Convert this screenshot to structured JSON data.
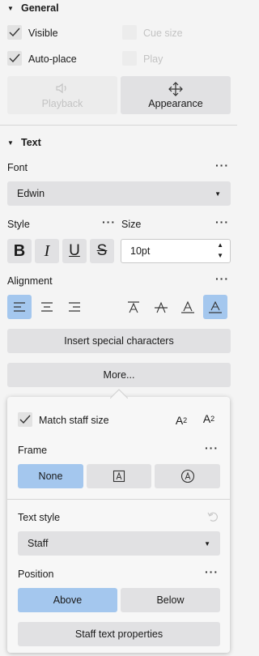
{
  "general": {
    "title": "General",
    "visible_label": "Visible",
    "autoplace_label": "Auto-place",
    "cuesize_label": "Cue size",
    "play_label": "Play",
    "playback_label": "Playback",
    "appearance_label": "Appearance"
  },
  "text": {
    "title": "Text",
    "font_label": "Font",
    "font_value": "Edwin",
    "style_label": "Style",
    "size_label": "Size",
    "size_value": "10pt",
    "alignment_label": "Alignment",
    "special_chars_label": "Insert special characters",
    "more_label": "More..."
  },
  "more_panel": {
    "match_staff_label": "Match staff size",
    "subscript_glyph": "A",
    "subscript_mark": "2",
    "superscript_glyph": "A",
    "superscript_mark": "2",
    "frame_label": "Frame",
    "frame_none_label": "None",
    "text_style_label": "Text style",
    "text_style_value": "Staff",
    "position_label": "Position",
    "position_above_label": "Above",
    "position_below_label": "Below",
    "staff_props_label": "Staff text properties"
  },
  "style_buttons": {
    "bold": "B",
    "italic": "I",
    "underline": "U",
    "strike": "S"
  },
  "colors": {
    "accent": "#a4c7ee",
    "button": "#e1e1e3",
    "background": "#f4f4f4"
  }
}
